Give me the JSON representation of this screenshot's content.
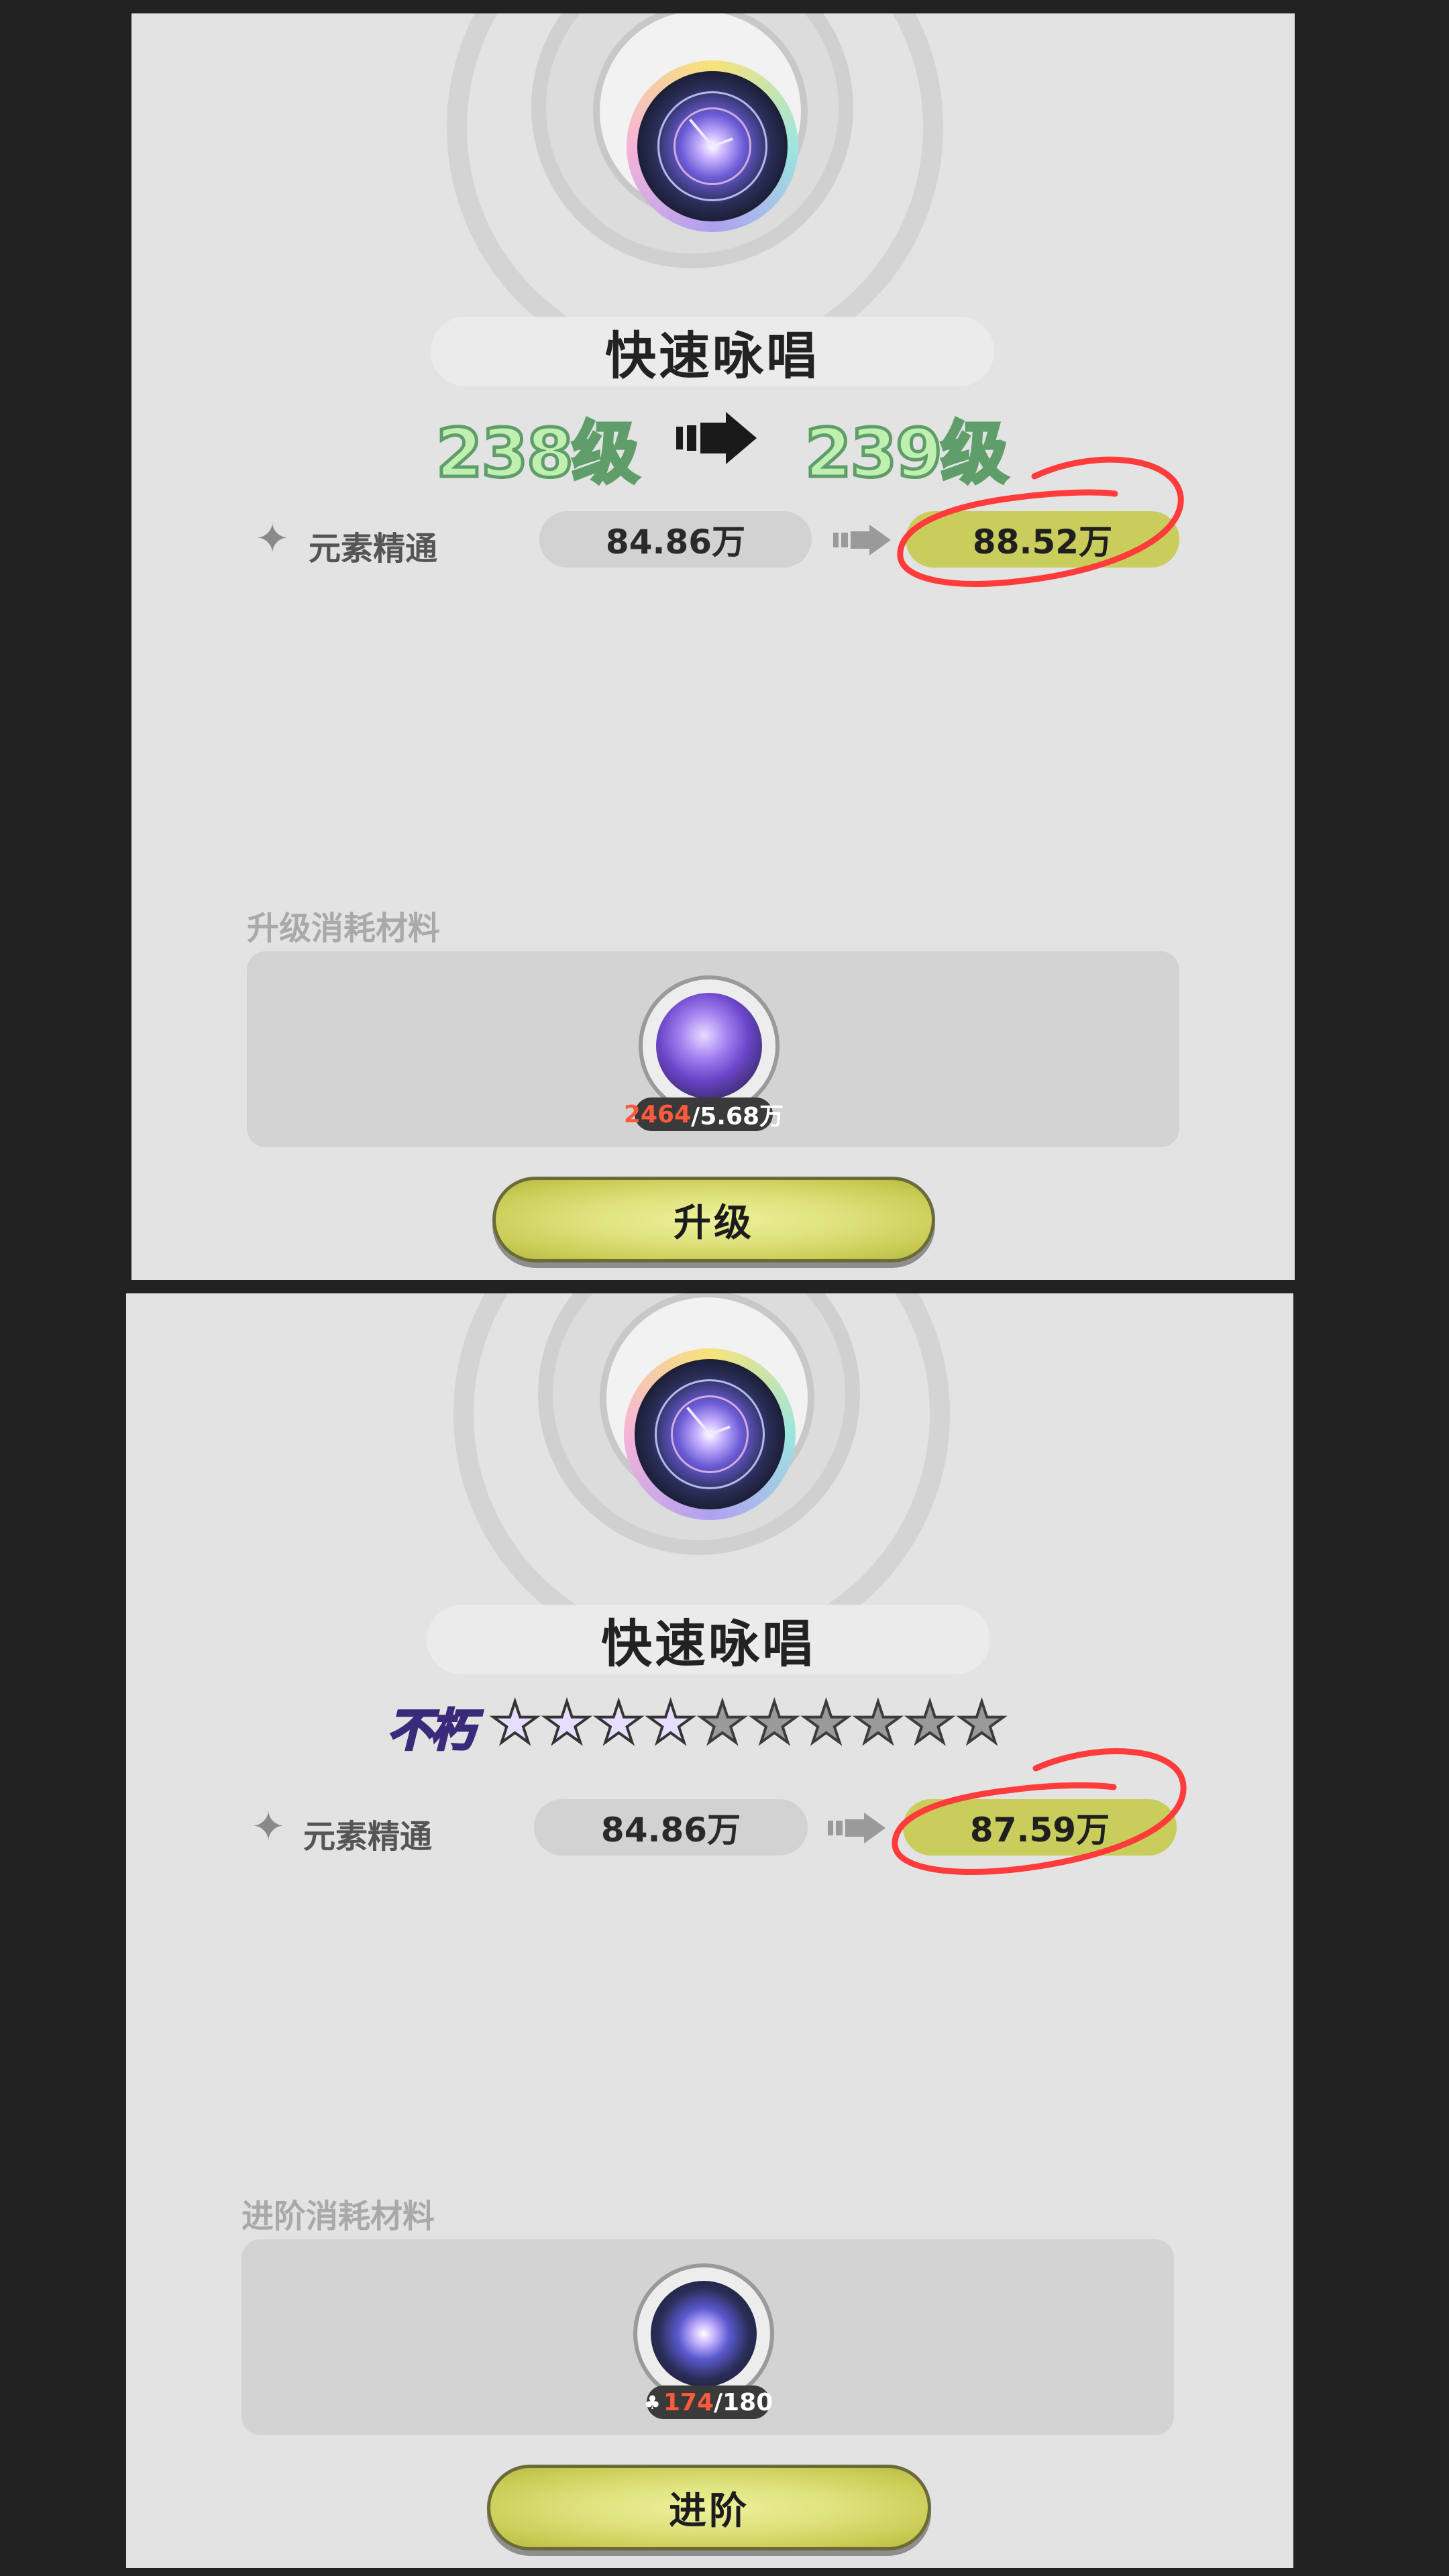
{
  "panels": [
    {
      "title": "快速咏唱",
      "level_from": "238级",
      "level_to": "239级",
      "stat": {
        "icon": "sparkle-icon",
        "label": "元素精通",
        "current": "84.86万",
        "next": "88.52万"
      },
      "materials_label": "升级消耗材料",
      "material": {
        "icon": "purple-crystal-icon",
        "have": "2464",
        "need": "/5.68万"
      },
      "button_label": "升级"
    },
    {
      "title": "快速咏唱",
      "rank_label": "不朽",
      "stars": {
        "filled": 4,
        "total": 10
      },
      "stat": {
        "icon": "sparkle-icon",
        "label": "元素精通",
        "current": "84.86万",
        "next": "87.59万"
      },
      "materials_label": "进阶消耗材料",
      "material": {
        "icon": "emblem-shard-icon",
        "have": "174",
        "need": "/180"
      },
      "button_label": "进阶"
    }
  ],
  "colors": {
    "accent_pill": "#c9cd5b",
    "annotation_red": "#ff3b3b",
    "insufficient": "#ff5a3c",
    "level_text": "#bff0b0"
  }
}
